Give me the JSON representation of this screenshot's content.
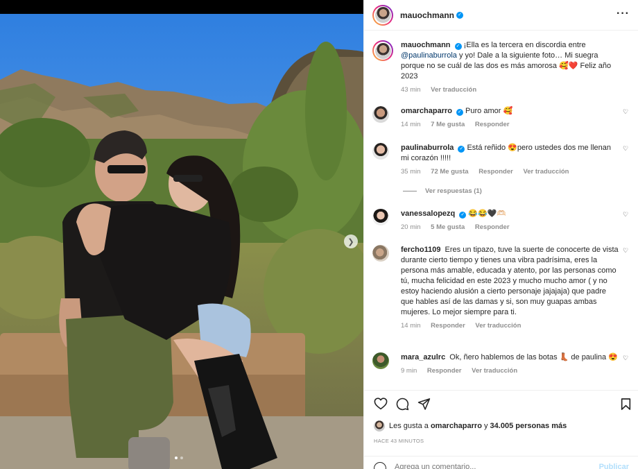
{
  "post": {
    "username": "mauochmann",
    "more_icon": "more-horizontal-icon"
  },
  "caption": {
    "username": "mauochmann",
    "text_before": "¡Ella es la tercera en discordia entre ",
    "mention": "@paulinaburrola",
    "text_after": " y yo! Dale a la siguiente foto… Mi suegra porque no se cuál de las dos es más amorosa 🥰❤️ Feliz año 2023",
    "time": "43 min",
    "translate": "Ver traducción"
  },
  "comments": [
    {
      "username": "omarchaparro",
      "verified": true,
      "text": "Puro amor 🥰",
      "time": "14 min",
      "likes": "7 Me gusta",
      "reply": "Responder",
      "translate": ""
    },
    {
      "username": "paulinaburrola",
      "verified": true,
      "text": "Está reñido 😍pero ustedes dos me llenan mi corazón !!!!!",
      "time": "35 min",
      "likes": "72 Me gusta",
      "reply": "Responder",
      "translate": "Ver traducción"
    },
    {
      "username": "vanessalopezq",
      "verified": true,
      "text": "😂😂🖤🫶🏻",
      "time": "20 min",
      "likes": "5 Me gusta",
      "reply": "Responder",
      "translate": ""
    },
    {
      "username": "fercho1109",
      "verified": false,
      "text": "Eres un tipazo, tuve la suerte de conocerte de vista durante cierto tiempo y tienes una vibra padrísima, eres la persona más amable, educada y atento, por las personas como tú, mucha felicidad en este 2023 y mucho mucho amor ( y no estoy haciendo alusión a cierto personaje jajajaja) que padre que hables así de las damas y si, son muy guapas ambas mujeres. Lo mejor siempre para ti.",
      "time": "14 min",
      "likes": "",
      "reply": "Responder",
      "translate": "Ver traducción"
    },
    {
      "username": "mara_azulrc",
      "verified": false,
      "text": "Ok, ñero hablemos de las botas 👢 de paulina 😍",
      "time": "9 min",
      "likes": "",
      "reply": "Responder",
      "translate": "Ver traducción"
    }
  ],
  "replies_link": "Ver respuestas (1)",
  "likes": {
    "prefix": "Les gusta a ",
    "user": "omarchaparro",
    "middle": " y ",
    "count": "34.005 personas más"
  },
  "timestamp": "HACE 43 MINUTOS",
  "compose": {
    "placeholder": "Agrega un comentario...",
    "publish": "Publicar"
  },
  "carousel": {
    "current": 1,
    "total": 2
  },
  "colors": {
    "verified": "#0095f6",
    "link": "#00376b",
    "muted": "#8e8e8e",
    "sky": "#3f8fe6"
  }
}
